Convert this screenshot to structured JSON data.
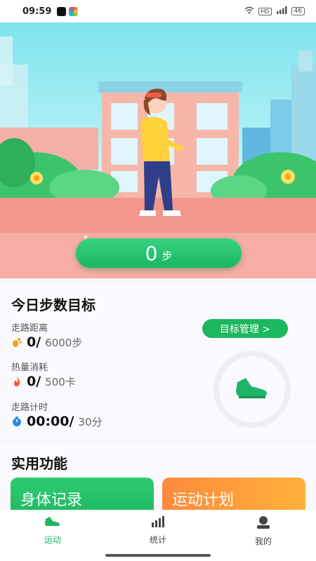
{
  "status_bar": {
    "time": "09:59",
    "network": "HD",
    "battery": "46"
  },
  "hero": {
    "steps": "0",
    "steps_unit": "步"
  },
  "goal": {
    "title": "今日步数目标",
    "manage_button": "目标管理 >",
    "metrics": [
      {
        "label": "走路距离",
        "current": "0/",
        "target": "6000步",
        "icon": "footprint-icon"
      },
      {
        "label": "热量消耗",
        "current": "0/",
        "target": "500卡",
        "icon": "flame-icon"
      },
      {
        "label": "走路计时",
        "current": "00:00/",
        "target": "30分",
        "icon": "timer-icon"
      }
    ]
  },
  "functions": {
    "title": "实用功能",
    "cards": [
      {
        "label": "身体记录"
      },
      {
        "label": "运动计划"
      }
    ]
  },
  "nav": {
    "items": [
      {
        "label": "运动",
        "icon": "sneaker-icon",
        "active": true
      },
      {
        "label": "统计",
        "icon": "bar-chart-icon",
        "active": false
      },
      {
        "label": "我的",
        "icon": "profile-icon",
        "active": false
      }
    ]
  },
  "colors": {
    "accent_green": "#1cb85f",
    "orange": "#ff8a3d"
  }
}
